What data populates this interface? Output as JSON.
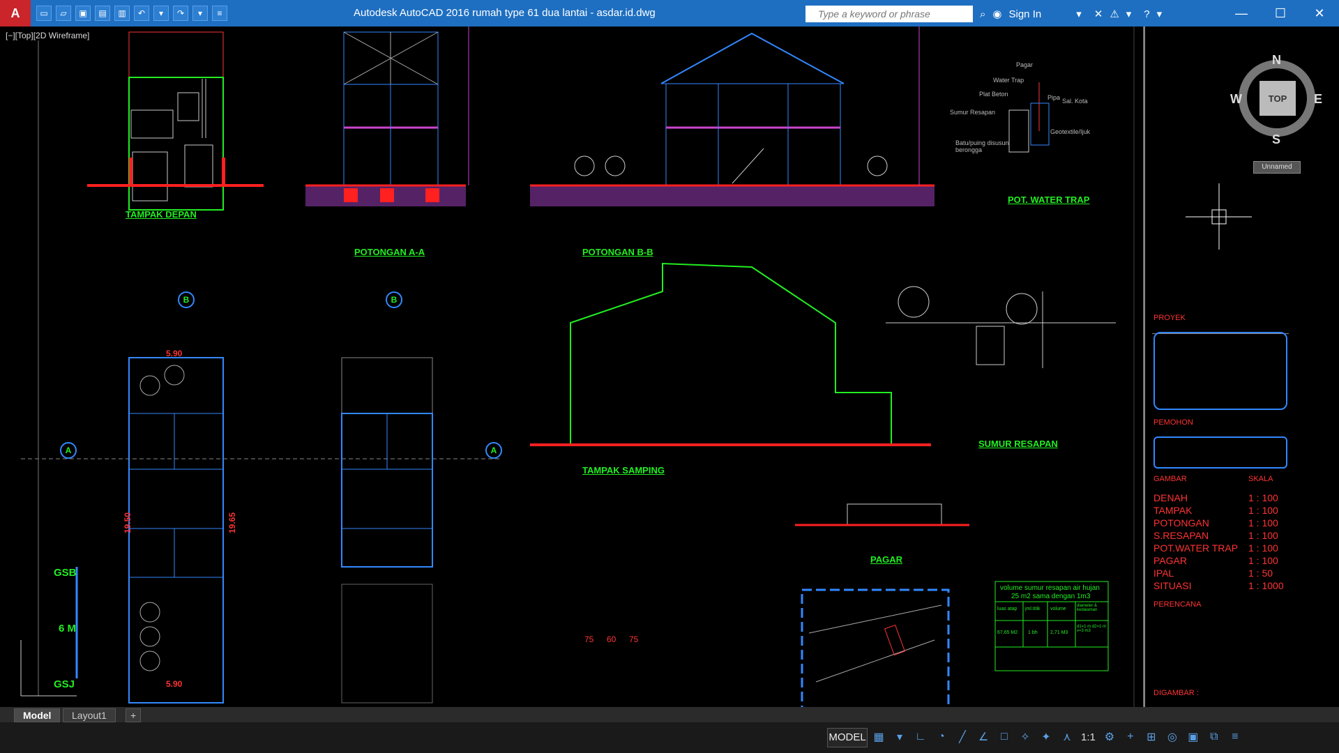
{
  "titlebar": {
    "app_letter": "A",
    "title": "Autodesk AutoCAD 2016        rumah type 61 dua lantai - asdar.id.dwg",
    "search_placeholder": "Type a keyword or phrase",
    "sign_in": "Sign In",
    "help": "?"
  },
  "viewport": {
    "label": "[−][Top][2D Wireframe]"
  },
  "viewcube": {
    "north": "N",
    "south": "S",
    "east": "E",
    "west": "W",
    "top": "TOP",
    "wcs": "Unnamed"
  },
  "drawing": {
    "tampak_depan": "TAMPAK DEPAN",
    "potongan_aa": "POTONGAN A-A",
    "potongan_bb": "POTONGAN B-B",
    "pot_water_trap": "POT. WATER TRAP",
    "tampak_samping": "TAMPAK SAMPING",
    "sumur_resapan": "SUMUR RESAPAN",
    "pagar": "PAGAR",
    "water_trap_labels": [
      "Pagar",
      "Water Trap",
      "Plat Beton",
      "Sumur Resapan",
      "Batu/puing disusun berongga",
      "Pipa",
      "Sal. Kota",
      "Geotextile/Ijuk"
    ],
    "dim_590_top": "5.90",
    "dim_590_bottom": "5.90",
    "dim_1950": "19.50",
    "dim_1965": "19.65",
    "gsb": "GSB",
    "six_m": "6 M",
    "gsj": "GSJ",
    "grid_a": "A",
    "grid_b": "B",
    "volume_title": "volume sumur resapan air hujan",
    "volume_sub": "25 m2 sama dengan 1m3",
    "volume_headers": [
      "luas atap",
      "jml.titik",
      "volume",
      "diameter & kedalaman"
    ],
    "volume_values": [
      "67,65 M2",
      "1 bh",
      "2,71 M3",
      "d1=1 m d2=1 m v=3 m3"
    ],
    "dims_bottom": [
      "75",
      "60",
      "75"
    ]
  },
  "titleblock": {
    "proyek": "PROYEK",
    "pemohon": "PEMOHON",
    "gambar": "GAMBAR",
    "skala": "SKALA",
    "rows": [
      {
        "name": "DENAH",
        "scale": "1 : 100"
      },
      {
        "name": "TAMPAK",
        "scale": "1 : 100"
      },
      {
        "name": "POTONGAN",
        "scale": "1 : 100"
      },
      {
        "name": "S.RESAPAN",
        "scale": "1 : 100"
      },
      {
        "name": "POT.WATER TRAP",
        "scale": "1 : 100"
      },
      {
        "name": "PAGAR",
        "scale": "1 : 100"
      },
      {
        "name": "IPAL",
        "scale": "1 : 50"
      },
      {
        "name": "SITUASI",
        "scale": "1 : 1000"
      }
    ],
    "perencana": "PERENCANA",
    "digambar": "DIGAMBAR  :"
  },
  "tabs": {
    "model": "Model",
    "layout1": "Layout1",
    "add": "+"
  },
  "statusbar": {
    "model": "MODEL",
    "scale": "1:1"
  },
  "colors": {
    "titlebar": "#1e6fc1",
    "cad_green": "#22ee22",
    "cad_red": "#ff2020",
    "cad_blue": "#3388ff",
    "cad_magenta": "#cc44cc",
    "cad_cyan": "#33dddd"
  }
}
